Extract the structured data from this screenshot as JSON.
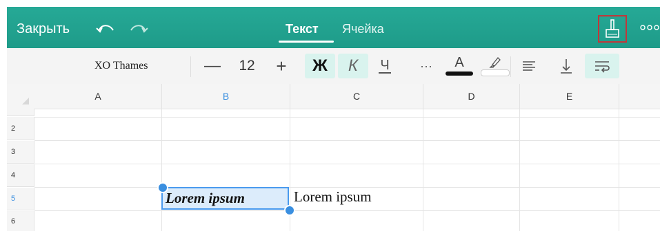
{
  "topbar": {
    "close_label": "Закрыть",
    "tabs": [
      {
        "label": "Текст",
        "active": true
      },
      {
        "label": "Ячейка",
        "active": false
      }
    ],
    "brush_icon": "brush-icon",
    "more_icon": "more-dots-icon",
    "accent": "#21a08e"
  },
  "toolbar": {
    "font_name": "XO Thames",
    "font_size": "12",
    "minus": "—",
    "plus": "+",
    "bold": "Ж",
    "italic": "К",
    "underline": "Ч",
    "more": "···",
    "font_color_glyph": "A",
    "highlight_icon": "highlighter-icon"
  },
  "grid": {
    "columns": [
      "A",
      "B",
      "C",
      "D",
      "E"
    ],
    "selected_column": "B",
    "rows": [
      "2",
      "3",
      "4",
      "5",
      "6"
    ],
    "selected_row": "5",
    "cells": {
      "B5": "Lorem ipsum",
      "C5": "Lorem ipsum"
    },
    "selection_color": "#3a8fe0"
  }
}
